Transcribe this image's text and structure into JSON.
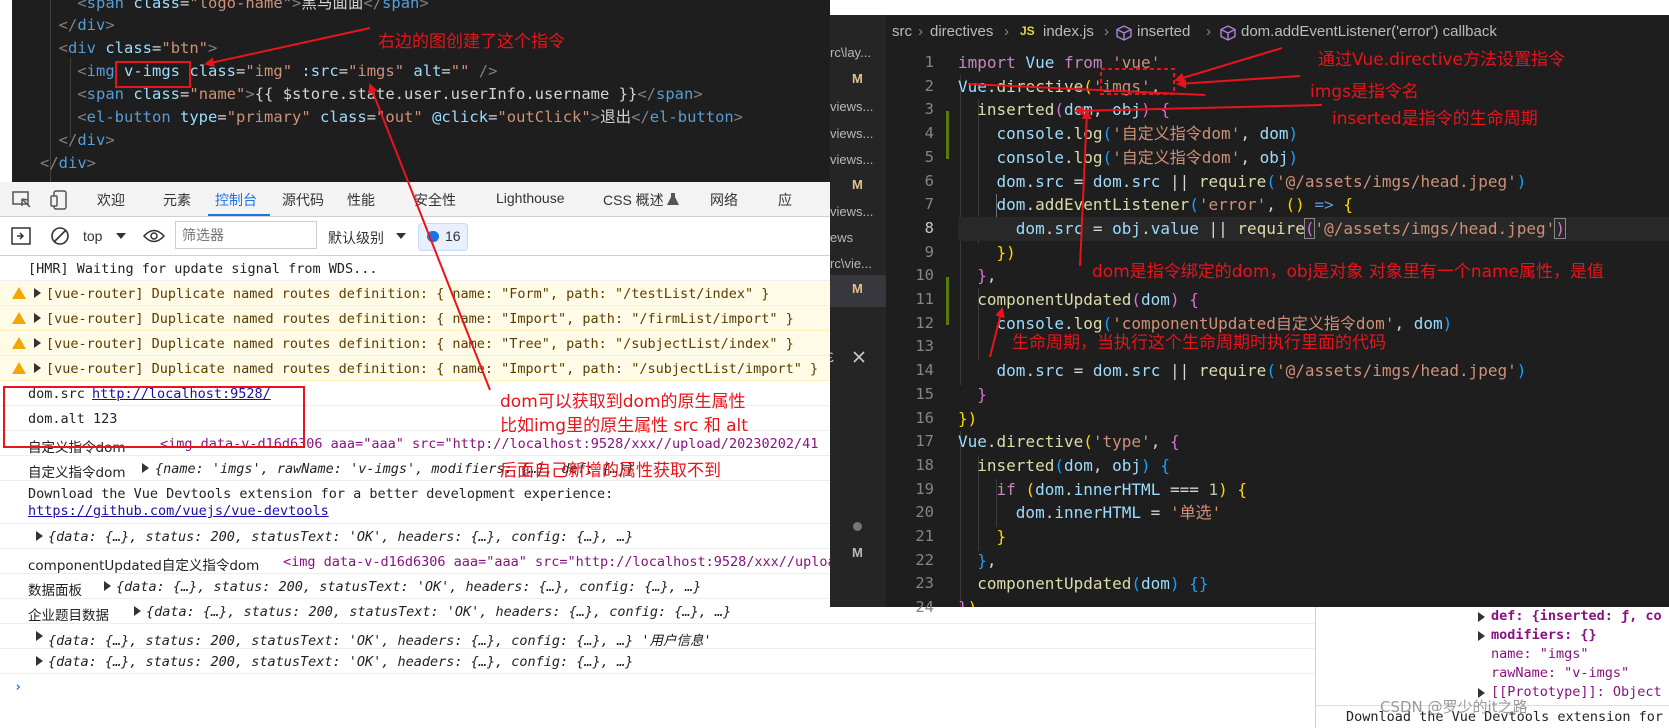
{
  "html_snippet": {
    "lines": [
      "    <span class=\"logo-name\">黑马面面</span>",
      "  </div>",
      "  <div class=\"btn\">",
      "    <img v-imgs class=\"img\" :src=\"imgs\" alt=\"\" />",
      "    <span class=\"name\">{{ $store.state.user.userInfo.username }}</span>",
      "    <el-button type=\"primary\" class=\"out\" @click=\"outClick\">退出</el-button>",
      "  </div>",
      "</div>"
    ]
  },
  "devtools": {
    "tabs": [
      "欢迎",
      "元素",
      "控制台",
      "源代码",
      "性能",
      "安全性",
      "Lighthouse",
      "CSS 概述",
      "网络",
      "应"
    ],
    "active_tab": "控制台",
    "context": "top",
    "filter_placeholder": "筛选器",
    "level": "默认级别",
    "issues_count": "16"
  },
  "console_rows": [
    {
      "type": "log",
      "text": "[HMR] Waiting for update signal from WDS..."
    },
    {
      "type": "warn",
      "text": "[vue-router] Duplicate named routes definition: { name: \"Form\", path: \"/testList/index\" }"
    },
    {
      "type": "warn",
      "text": "[vue-router] Duplicate named routes definition: { name: \"Import\", path: \"/firmList/import\" }"
    },
    {
      "type": "warn",
      "text": "[vue-router] Duplicate named routes definition: { name: \"Tree\", path: \"/subjectList/index\" }"
    },
    {
      "type": "warn",
      "text": "[vue-router] Duplicate named routes definition: { name: \"Import\", path: \"/subjectList/import\" }"
    },
    {
      "type": "log",
      "label": "dom.src ",
      "link": "http://localhost:9528/"
    },
    {
      "type": "log",
      "text": "dom.alt 123"
    },
    {
      "type": "log",
      "label": "自定义指令dom",
      "rest": "<img data-v-d16d6306 aaa=\"aaa\" src=\"http://localhost:9528/xxx//upload/20230202/41"
    },
    {
      "type": "log",
      "label": "自定义指令dom",
      "obj": "{name: 'imgs', rawName: 'v-imgs', modifiers: {…}, def: {…}}"
    },
    {
      "type": "log",
      "text": "Download the Vue Devtools extension for a better development experience:",
      "link": "https://github.com/vuejs/vue-devtools"
    },
    {
      "type": "log",
      "obj": "{data: {…}, status: 200, statusText: 'OK', headers: {…}, config: {…}, …}"
    },
    {
      "type": "log",
      "label": "componentUpdated自定义指令dom",
      "rest": "<img data-v-d16d6306 aaa=\"aaa\" src=\"http://localhost:9528/xxx//upload/20230202/41"
    },
    {
      "type": "log",
      "label": "数据面板",
      "obj": "{data: {…}, status: 200, statusText: 'OK', headers: {…}, config: {…}, …}"
    },
    {
      "type": "log",
      "label": "企业题目数据",
      "obj": "{data: {…}, status: 200, statusText: 'OK', headers: {…}, config: {…}, …}"
    },
    {
      "type": "log",
      "obj": "{data: {…}, status: 200, statusText: 'OK', headers: {…}, config: {…}, …} '用户信息'"
    },
    {
      "type": "log",
      "obj": "{data: {…}, status: 200, statusText: 'OK', headers: {…}, config: {…}, …}"
    }
  ],
  "prompt_symbol": "›",
  "editor": {
    "breadcrumb": [
      "src",
      "directives",
      "JS",
      "index.js",
      "inserted",
      "dom.addEventListener('error') callback"
    ],
    "explorer_items": [
      "rc\\lay...",
      "M",
      "views...",
      "views...",
      "views...",
      "M",
      "views...",
      "ews",
      "rc\\vie...",
      "M",
      "M"
    ],
    "line_numbers": [
      "1",
      "2",
      "3",
      "4",
      "5",
      "6",
      "7",
      "8",
      "9",
      "10",
      "11",
      "12",
      "13",
      "14",
      "15",
      "16",
      "17",
      "18",
      "19",
      "20",
      "21",
      "22",
      "23",
      "24"
    ],
    "current_line": "8"
  },
  "right_devtools": {
    "lines": [
      "def: {inserted: ƒ, co",
      "modifiers: {}",
      "name: \"imgs\"",
      "rawName: \"v-imgs\"",
      "[[Prototype]]: Object",
      "Download the Vue Devtools extension for"
    ]
  },
  "annotations": {
    "a1": "右边的图创建了这个指令",
    "a2": "通过Vue.directive方法设置指令",
    "a3": "imgs是指令名",
    "a4": "inserted是指令的生命周期",
    "a5": "dom是指令绑定的dom，obj是对象  对象里有一个name属性，是值",
    "a6": "生命周期，当执行这个生命周期时执行里面的代码",
    "a7": "dom可以获取到dom的原生属性",
    "a8": "比如img里的原生属性  src  和  alt",
    "a9": "后面自己新增的属性获取不到"
  },
  "watermark": "CSDN @罗少的it之路",
  "colors": {
    "annotation": "#e8141b",
    "accent": "#1a73e8",
    "editor_bg": "#1e1e1e"
  }
}
